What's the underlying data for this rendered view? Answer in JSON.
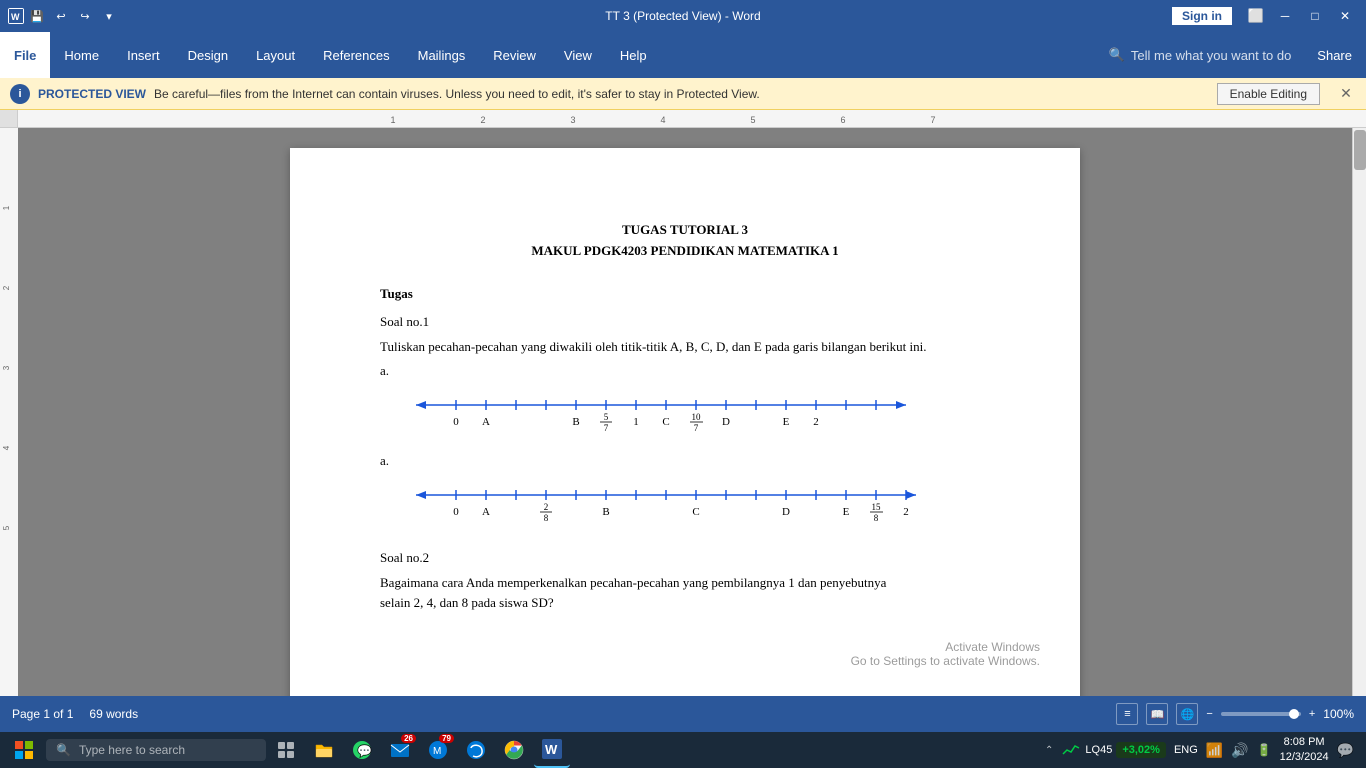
{
  "titlebar": {
    "title": "TT 3 (Protected View) - Word",
    "sign_in_label": "Sign in"
  },
  "quickaccess": {
    "save": "💾",
    "undo": "↩",
    "redo": "↪",
    "dropdown": "▾"
  },
  "ribbon": {
    "tabs": [
      {
        "label": "File",
        "active": false
      },
      {
        "label": "Home",
        "active": false
      },
      {
        "label": "Insert",
        "active": false
      },
      {
        "label": "Design",
        "active": false
      },
      {
        "label": "Layout",
        "active": false
      },
      {
        "label": "References",
        "active": false
      },
      {
        "label": "Mailings",
        "active": false
      },
      {
        "label": "Review",
        "active": false
      },
      {
        "label": "View",
        "active": false
      },
      {
        "label": "Help",
        "active": false
      }
    ],
    "search_placeholder": "Tell me what you want to do",
    "share_label": "Share"
  },
  "protected_bar": {
    "label": "PROTECTED VIEW",
    "message": "Be careful—files from the Internet can contain viruses. Unless you need to edit, it's safer to stay in Protected View.",
    "button_label": "Enable Editing"
  },
  "document": {
    "title_line1": "TUGAS TUTORIAL 3",
    "title_line2": "MAKUL PDGK4203 PENDIDIKAN MATEMATIKA 1",
    "section1_title": "Tugas",
    "soal1_label": "Soal no.1",
    "soal1_text": "Tuliskan pecahan-pecahan yang diwakili oleh titik-titik A, B, C, D, dan E pada garis bilangan berikut ini.",
    "line1_label": "a.",
    "line2_label": "a.",
    "soal2_label": "Soal no.2",
    "soal2_text": "Bagaimana cara Anda memperkenalkan pecahan-pecahan yang pembilangnya 1 dan penyebutnya selain 2, 4, dan 8 pada siswa SD?"
  },
  "status": {
    "page_info": "Page 1 of 1",
    "word_count": "69 words",
    "zoom": "100%"
  },
  "taskbar": {
    "search_placeholder": "Type here to search",
    "time": "8:08 PM",
    "date": "12/3/2024",
    "language": "ENG",
    "stock": "LQ45",
    "stock_value": "+3,02%",
    "activate_line1": "Activate Windows",
    "activate_line2": "Go to Settings to activate Windows."
  },
  "icons": {
    "start": "⊞",
    "search": "🔍",
    "taskview": "☰",
    "explorer": "📁",
    "whatsapp": "💬",
    "edge": "🌐",
    "chrome": "◎",
    "word": "W"
  }
}
